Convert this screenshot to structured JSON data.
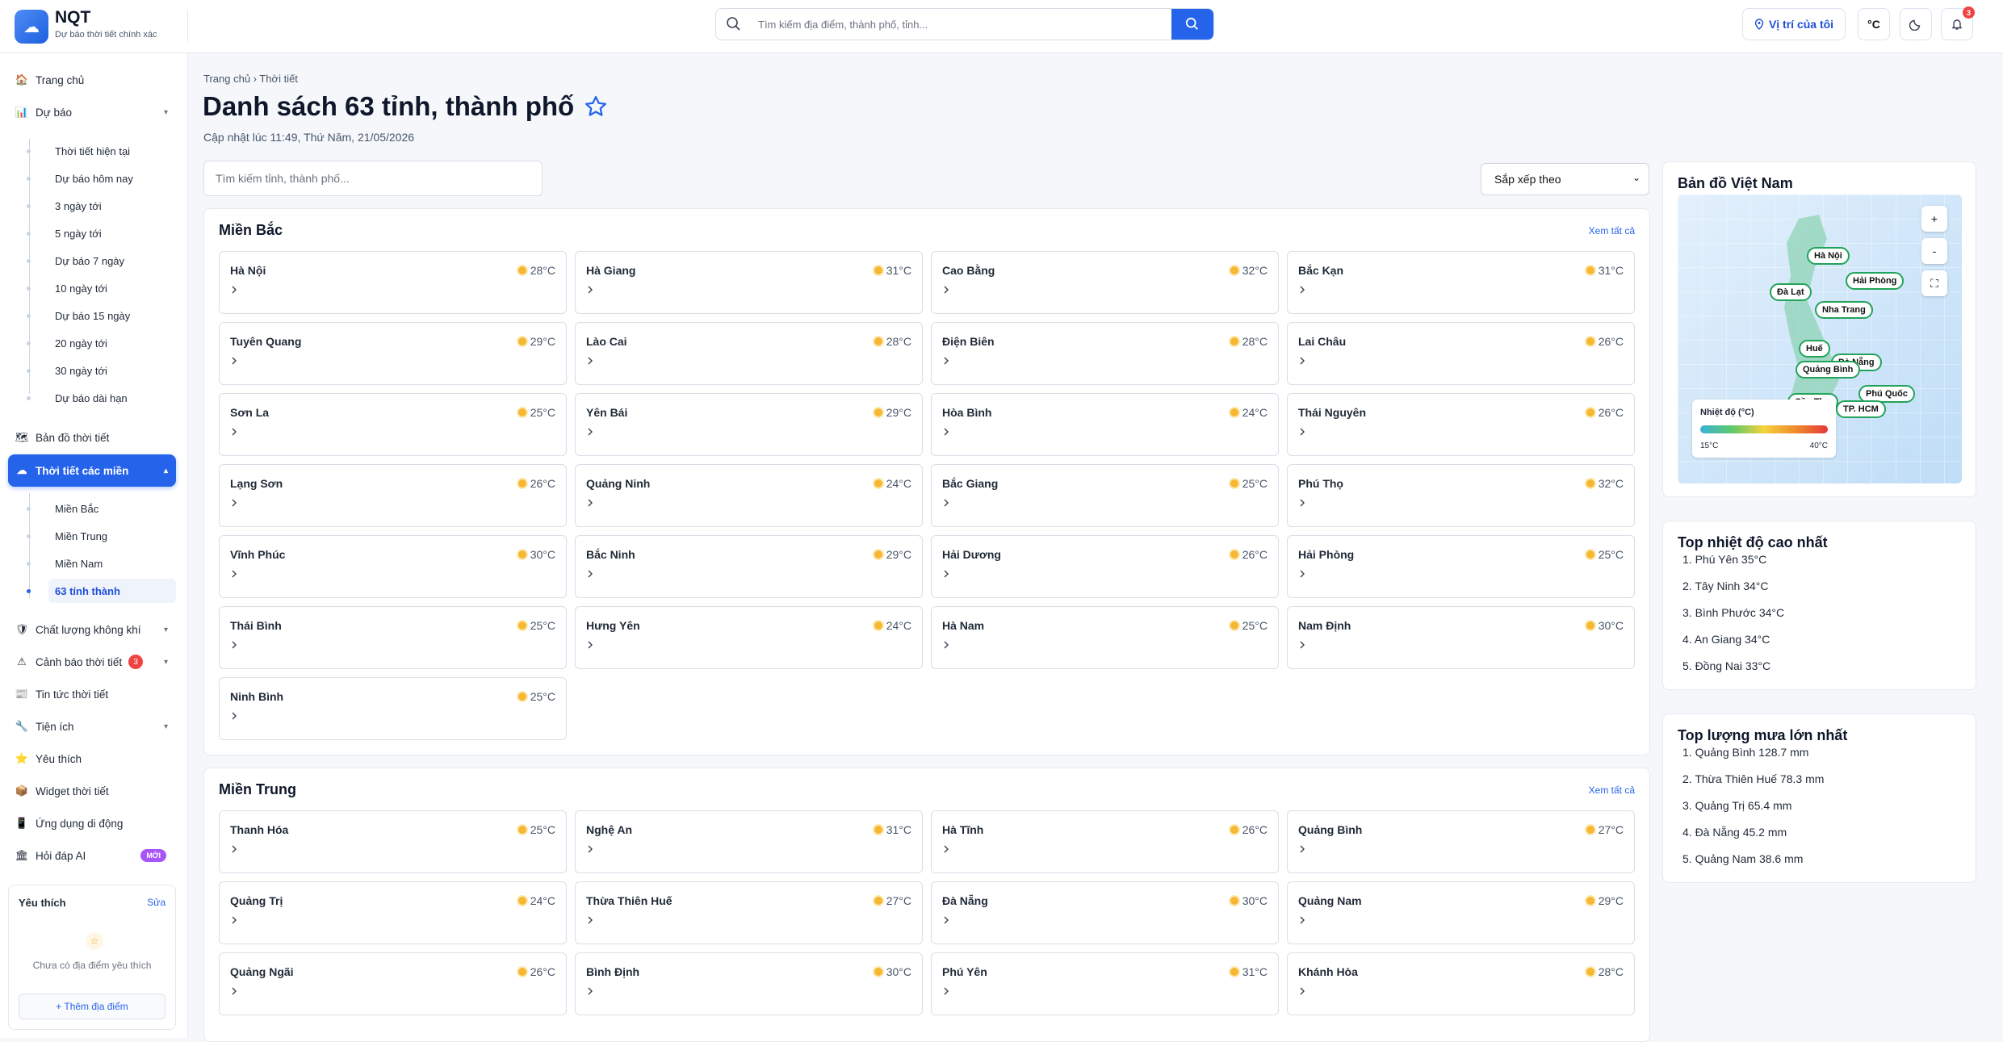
{
  "app": {
    "name": "NQT",
    "tagline": "Dự báo thời tiết chính xác"
  },
  "search": {
    "placeholder": "Tìm kiếm địa điểm, thành phố, tỉnh..."
  },
  "header": {
    "location_label": "Vị trí của tôi",
    "unit_label": "°C",
    "notif_count": "3"
  },
  "sidebar": {
    "items": [
      {
        "label": "Trang chủ",
        "icon": "🏠"
      },
      {
        "label": "Dự báo",
        "icon": "📊",
        "chev": "▾"
      },
      {
        "label": "Bản đồ thời tiết",
        "icon": "🗺"
      },
      {
        "label": "Thời tiết các miền",
        "icon": "☁",
        "chev": "▴"
      },
      {
        "label": "Chất lượng không khí",
        "icon": "🛡",
        "chev": "▾"
      },
      {
        "label": "Cảnh báo thời tiết",
        "icon": "⚠",
        "chev": "▾",
        "badge": "3"
      },
      {
        "label": "Tin tức thời tiết",
        "icon": "📰"
      },
      {
        "label": "Tiện ích",
        "icon": "🔧",
        "chev": "▾"
      },
      {
        "label": "Yêu thích",
        "icon": "⭐"
      },
      {
        "label": "Widget thời tiết",
        "icon": "📦"
      },
      {
        "label": "Ứng dụng di động",
        "icon": "📱"
      },
      {
        "label": "Hỏi đáp AI",
        "icon": "🏛",
        "badge": "MỚI"
      }
    ],
    "forecast_sub": [
      "Thời tiết hiện tại",
      "Dự báo hôm nay",
      "3 ngày tới",
      "5 ngày tới",
      "Dự báo 7 ngày",
      "10 ngày tới",
      "Dự báo 15 ngày",
      "20 ngày tới",
      "30 ngày tới",
      "Dự báo dài hạn"
    ],
    "region_sub": [
      "Miền Bắc",
      "Miền Trung",
      "Miền Nam",
      "63 tỉnh thành"
    ],
    "favorites": {
      "title": "Yêu thích",
      "edit": "Sửa",
      "empty": "Chưa có địa điểm yêu thích",
      "add": "+ Thêm địa điểm"
    }
  },
  "main": {
    "breadcrumb": "Trang chủ › Thời tiết",
    "title": "Danh sách 63 tỉnh, thành phố",
    "updated": "Cập nhật lúc 11:49, Thứ Năm, 21/05/2026",
    "province_search_placeholder": "Tìm kiếm tỉnh, thành phố...",
    "sort_label": "Sắp xếp theo",
    "see_all": "Xem tất cả",
    "regions": [
      {
        "name": "Miền Bắc",
        "provinces": [
          {
            "name": "Hà Nội",
            "temp": "28°C"
          },
          {
            "name": "Hà Giang",
            "temp": "31°C"
          },
          {
            "name": "Cao Bằng",
            "temp": "32°C"
          },
          {
            "name": "Bắc Kạn",
            "temp": "31°C"
          },
          {
            "name": "Tuyên Quang",
            "temp": "29°C"
          },
          {
            "name": "Lào Cai",
            "temp": "28°C"
          },
          {
            "name": "Điện Biên",
            "temp": "28°C"
          },
          {
            "name": "Lai Châu",
            "temp": "26°C"
          },
          {
            "name": "Sơn La",
            "temp": "25°C"
          },
          {
            "name": "Yên Bái",
            "temp": "29°C"
          },
          {
            "name": "Hòa Bình",
            "temp": "24°C"
          },
          {
            "name": "Thái Nguyên",
            "temp": "26°C"
          },
          {
            "name": "Lạng Sơn",
            "temp": "26°C"
          },
          {
            "name": "Quảng Ninh",
            "temp": "24°C"
          },
          {
            "name": "Bắc Giang",
            "temp": "25°C"
          },
          {
            "name": "Phú Thọ",
            "temp": "32°C"
          },
          {
            "name": "Vĩnh Phúc",
            "temp": "30°C"
          },
          {
            "name": "Bắc Ninh",
            "temp": "29°C"
          },
          {
            "name": "Hải Dương",
            "temp": "26°C"
          },
          {
            "name": "Hải Phòng",
            "temp": "25°C"
          },
          {
            "name": "Thái Bình",
            "temp": "25°C"
          },
          {
            "name": "Hưng Yên",
            "temp": "24°C"
          },
          {
            "name": "Hà Nam",
            "temp": "25°C"
          },
          {
            "name": "Nam Định",
            "temp": "30°C"
          },
          {
            "name": "Ninh Bình",
            "temp": "25°C"
          }
        ]
      },
      {
        "name": "Miền Trung",
        "provinces": [
          {
            "name": "Thanh Hóa",
            "temp": "25°C"
          },
          {
            "name": "Nghệ An",
            "temp": "31°C"
          },
          {
            "name": "Hà Tĩnh",
            "temp": "26°C"
          },
          {
            "name": "Quảng Bình",
            "temp": "27°C"
          },
          {
            "name": "Quảng Trị",
            "temp": "24°C"
          },
          {
            "name": "Thừa Thiên Huế",
            "temp": "27°C"
          },
          {
            "name": "Đà Nẵng",
            "temp": "30°C"
          },
          {
            "name": "Quảng Nam",
            "temp": "29°C"
          },
          {
            "name": "Quảng Ngãi",
            "temp": "26°C"
          },
          {
            "name": "Bình Định",
            "temp": "30°C"
          },
          {
            "name": "Phú Yên",
            "temp": "31°C"
          },
          {
            "name": "Khánh Hòa",
            "temp": "28°C"
          }
        ]
      }
    ]
  },
  "right": {
    "map": {
      "title": "Bản đồ Việt Nam",
      "legend_title": "Nhiệt độ (°C)",
      "legend_min": "15°C",
      "legend_max": "40°C",
      "pins": [
        "Hà Nội",
        "Hải Phòng",
        "Đà Lạt",
        "Nha Trang",
        "Huế",
        "Đà Nẵng",
        "Quảng Bình",
        "Phú Quốc",
        "Cần Thơ",
        "TP. HCM"
      ]
    },
    "top_temp": {
      "title": "Top nhiệt độ cao nhất",
      "items": [
        "1. Phú Yên 35°C",
        "2. Tây Ninh 34°C",
        "3. Bình Phước 34°C",
        "4. An Giang 34°C",
        "5. Đồng Nai 33°C"
      ]
    },
    "top_rain": {
      "title": "Top lượng mưa lớn nhất",
      "items": [
        "1. Quảng Bình 128.7 mm",
        "2. Thừa Thiên Huế 78.3 mm",
        "3. Quảng Trị 65.4 mm",
        "4. Đà Nẵng 45.2 mm",
        "5. Quảng Nam 38.6 mm"
      ]
    }
  },
  "colors": {
    "accent": "#2563eb",
    "badge": "#ef4444",
    "new_badge": "#a855f7",
    "sun": "#f6b733"
  }
}
